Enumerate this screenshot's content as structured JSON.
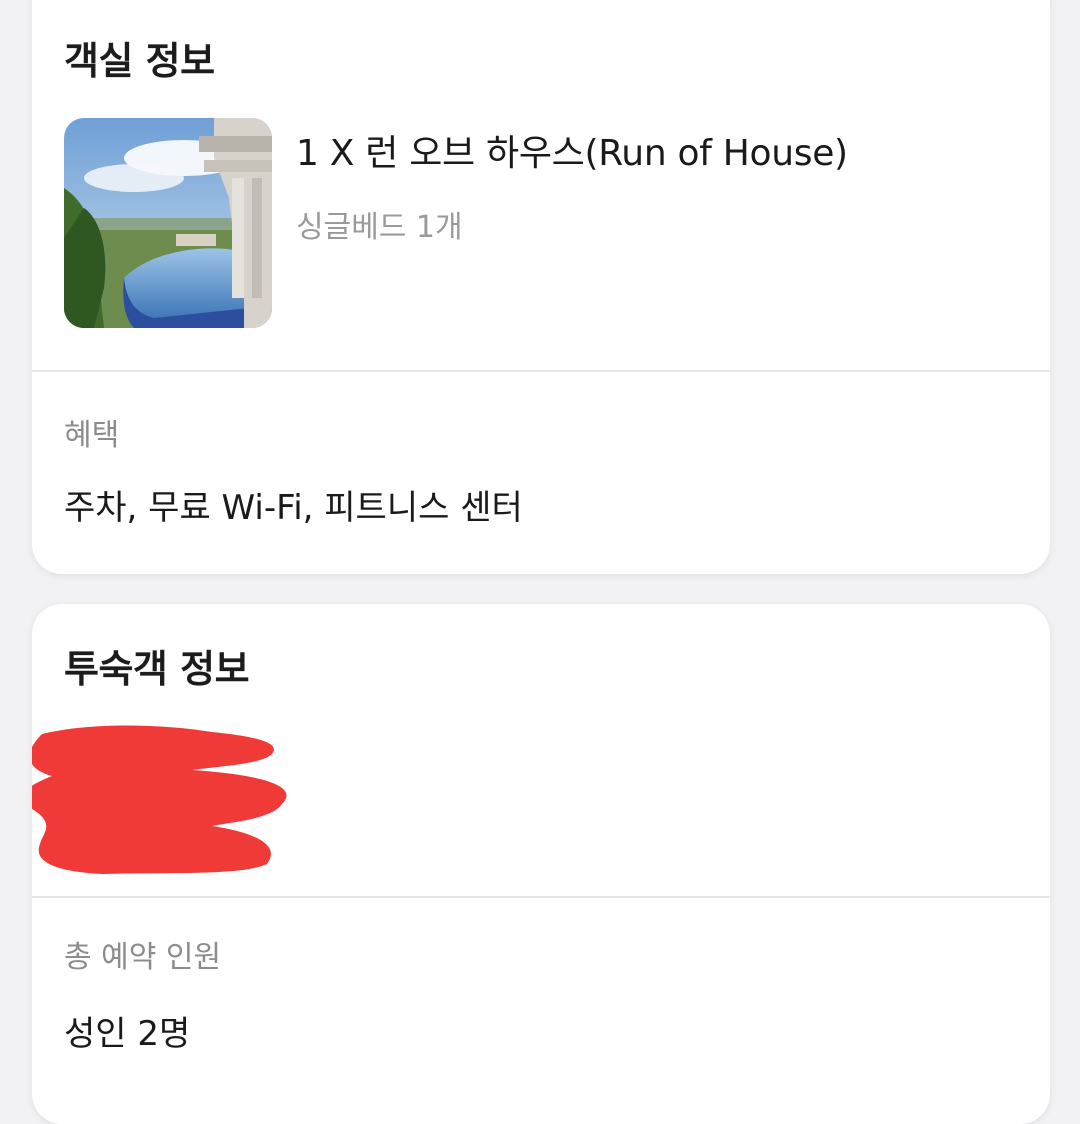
{
  "room_section": {
    "title": "객실 정보",
    "room_name": "1 X 런 오브 하우스(Run of House)",
    "bed_info": "싱글베드 1개",
    "benefits_label": "혜택",
    "benefits_value": "주차, 무료 Wi-Fi, 피트니스 센터"
  },
  "guest_section": {
    "title": "투숙객 정보",
    "total_guests_label": "총 예약 인원",
    "total_guests_value": "성인 2명"
  },
  "colors": {
    "background": "#f2f2f4",
    "card": "#ffffff",
    "text_primary": "#1a1a1a",
    "text_secondary": "#8c8c8c",
    "redaction": "#f03a38"
  },
  "icons": {
    "room_image": "hotel-pool-photo"
  }
}
